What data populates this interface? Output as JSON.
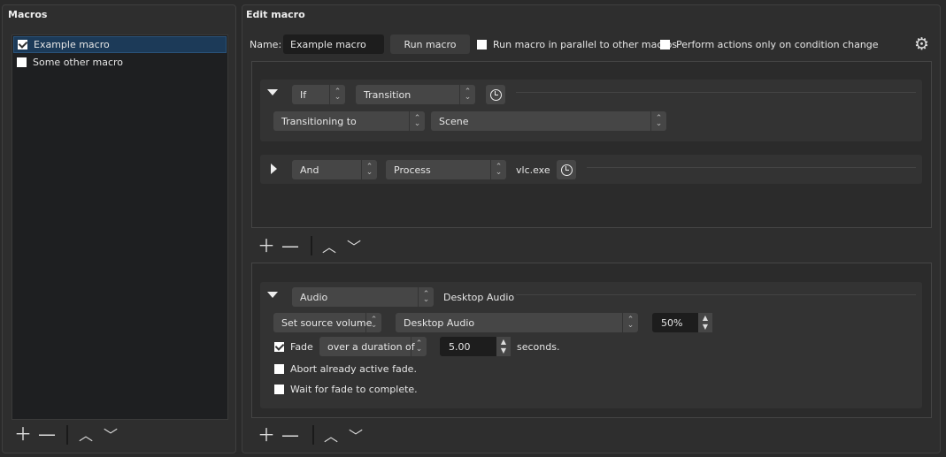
{
  "macros_panel": {
    "title": "Macros",
    "items": [
      {
        "label": "Example macro",
        "checked": true,
        "selected": true
      },
      {
        "label": "Some other macro",
        "checked": false,
        "selected": false
      }
    ]
  },
  "edit_panel": {
    "title": "Edit macro",
    "name_label": "Name:",
    "name_value": "Example macro",
    "run_button": "Run macro",
    "parallel_label": "Run macro in parallel to other macros",
    "parallel_checked": false,
    "on_change_label": "Perform actions only on condition change",
    "on_change_checked": false
  },
  "conditions": [
    {
      "logic": "If",
      "type": "Transition",
      "expanded": true,
      "sub1": "Transitioning to",
      "sub2": "Scene"
    },
    {
      "logic": "And",
      "type": "Process",
      "expanded": false,
      "value": "vlc.exe"
    }
  ],
  "action": {
    "type": "Audio",
    "source_label": "Desktop Audio",
    "expanded": true,
    "action": "Set source volume",
    "source": "Desktop Audio",
    "volume": "50%",
    "fade_label": "Fade",
    "fade_checked": true,
    "fade_mode": "over a duration of",
    "duration": "5.00",
    "seconds_label": "seconds.",
    "abort_label": "Abort already active fade.",
    "abort_checked": false,
    "wait_label": "Wait for fade to complete.",
    "wait_checked": false
  },
  "toolbar_icons": [
    "plus-icon",
    "minus-icon",
    "up-icon",
    "down-icon"
  ]
}
